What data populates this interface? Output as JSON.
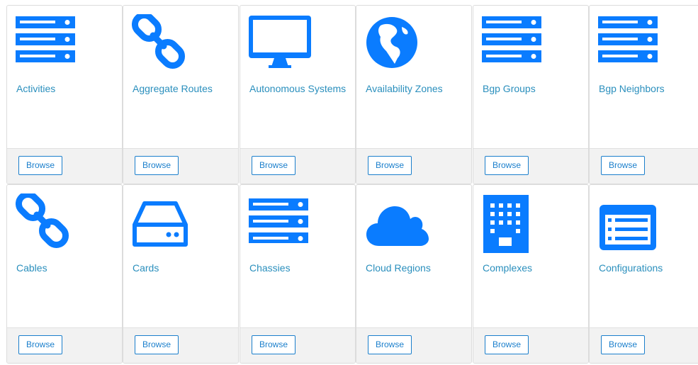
{
  "theme": {
    "icon_color": "#0a7cff",
    "title_color": "#2a8fbd",
    "footer_bg": "#f2f2f2",
    "button_border": "#1b7fcc"
  },
  "cards": [
    {
      "title": "Activities",
      "icon": "server-icon",
      "button": "Browse"
    },
    {
      "title": "Aggregate Routes",
      "icon": "link-icon",
      "button": "Browse"
    },
    {
      "title": "Autonomous Systems",
      "icon": "desktop-icon",
      "button": "Browse"
    },
    {
      "title": "Availability Zones",
      "icon": "globe-icon",
      "button": "Browse"
    },
    {
      "title": "Bgp Groups",
      "icon": "server-icon",
      "button": "Browse"
    },
    {
      "title": "Bgp Neighbors",
      "icon": "server-icon",
      "button": "Browse"
    },
    {
      "title": "Cables",
      "icon": "link-icon",
      "button": "Browse"
    },
    {
      "title": "Cards",
      "icon": "hard-drive-icon",
      "button": "Browse"
    },
    {
      "title": "Chassies",
      "icon": "server-icon",
      "button": "Browse"
    },
    {
      "title": "Cloud Regions",
      "icon": "cloud-icon",
      "button": "Browse"
    },
    {
      "title": "Complexes",
      "icon": "building-icon",
      "button": "Browse"
    },
    {
      "title": "Configurations",
      "icon": "list-alt-icon",
      "button": "Browse"
    }
  ]
}
